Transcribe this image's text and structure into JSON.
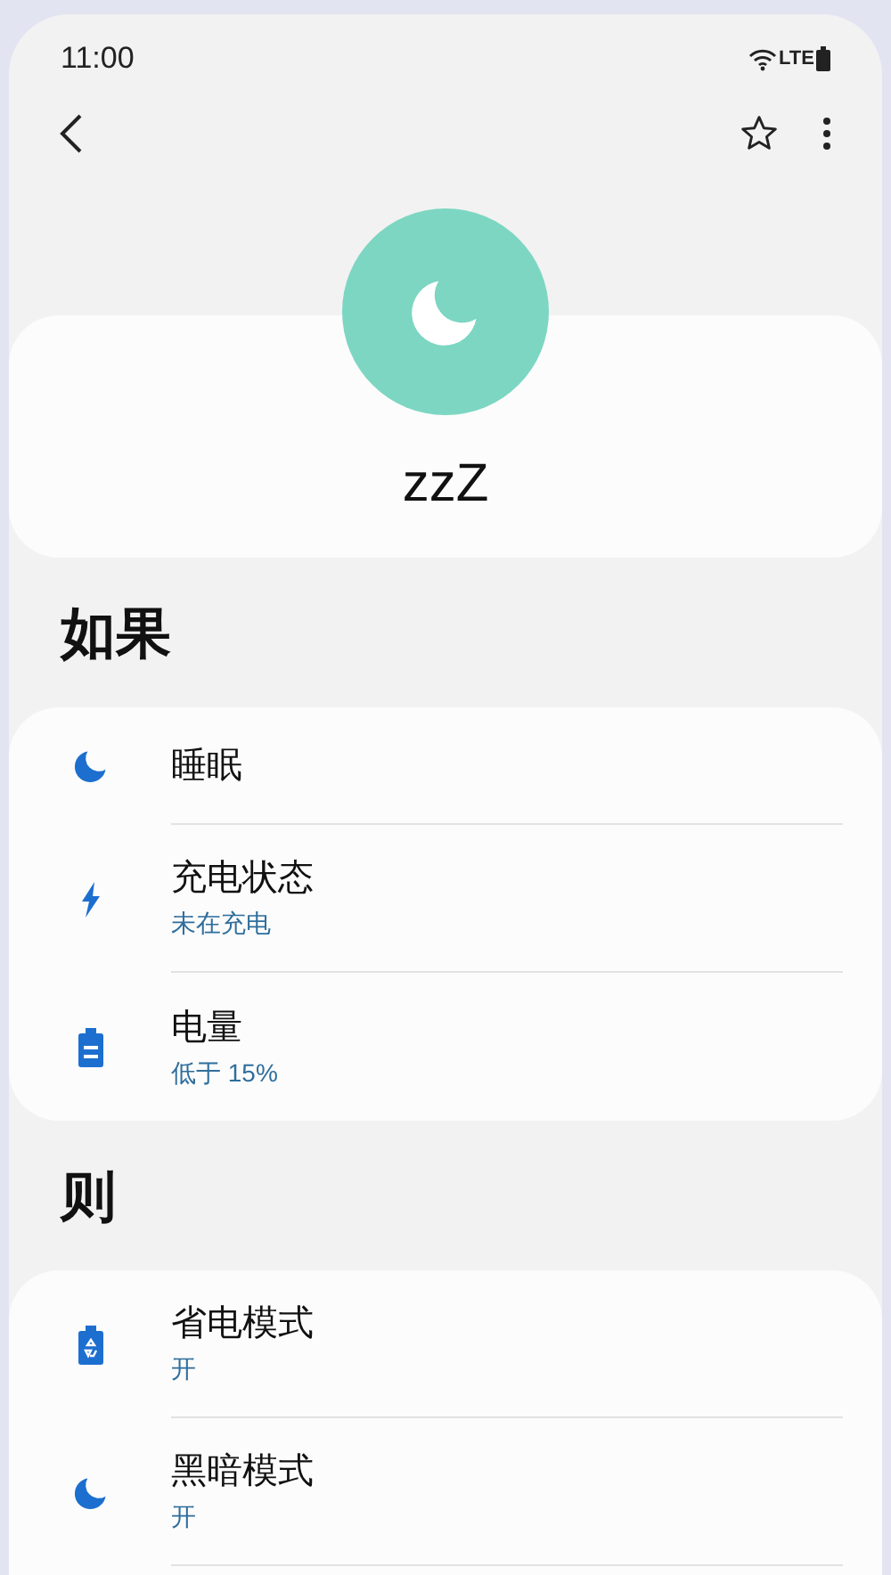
{
  "status_bar": {
    "time": "11:00",
    "network": "LTE"
  },
  "profile": {
    "name": "zzZ"
  },
  "sections": [
    {
      "heading": "如果",
      "continues": false,
      "rows": [
        {
          "kind": "moon",
          "title": "睡眠"
        },
        {
          "kind": "bolt",
          "title": "充电状态",
          "subtitle": "未在充电"
        },
        {
          "kind": "battery",
          "title": "电量",
          "subtitle": "低于 15%"
        }
      ]
    },
    {
      "heading": "则",
      "continues": true,
      "rows": [
        {
          "kind": "battery-saver",
          "title": "省电模式",
          "subtitle": "开"
        },
        {
          "kind": "moon",
          "title": "黑暗模式",
          "subtitle": "开"
        }
      ]
    }
  ]
}
